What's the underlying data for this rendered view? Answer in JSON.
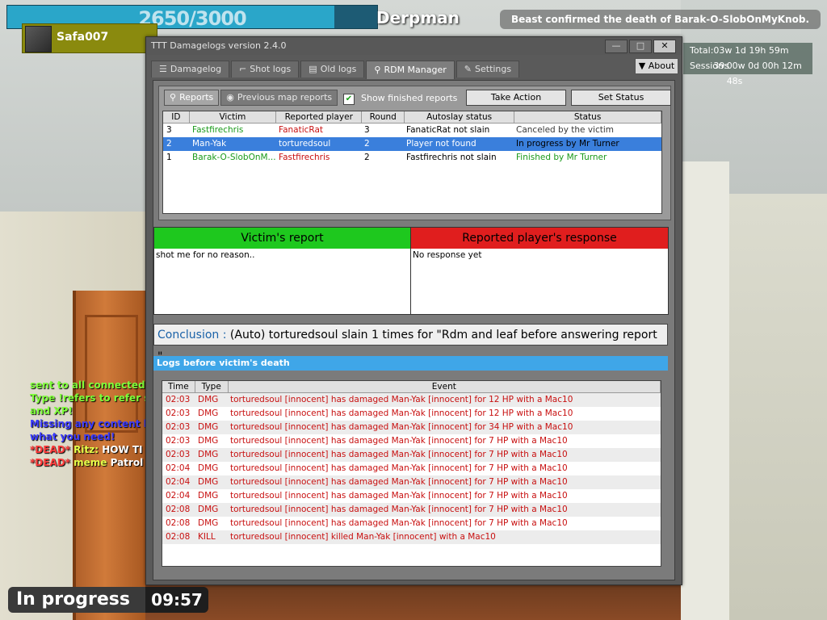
{
  "hud": {
    "health": "2650/3000",
    "health_fraction": 0.8833,
    "target_name": "Derpman",
    "player_name": "Safa007",
    "killfeed": "Beast confirmed the death of Barak-O-SlobOnMyKnob.",
    "time_total_label": "Total:",
    "time_total_value": "03w 1d 19h 59m 39s",
    "time_session_label": "Session:",
    "time_session_value": "00w 0d 00h 12m 48s",
    "round_state": "In progress",
    "round_timer": "09:57",
    "chat": [
      {
        "text": "sent to all connected s",
        "color": "#7fff3a"
      },
      {
        "text": "Type !refers to refer s",
        "color": "#7fff3a"
      },
      {
        "text": "and XP!",
        "color": "#7fff3a"
      },
      {
        "text": "Missing any content li",
        "color": "#3c3cff"
      },
      {
        "text": "what you need!",
        "color": "#3c3cff"
      },
      {
        "prefix": "*DEAD*",
        "name": "Ritz:",
        "text": "HOW TI"
      },
      {
        "prefix": "*DEAD*",
        "name": "meme",
        "text": "Patrol"
      }
    ]
  },
  "window": {
    "title": "TTT Damagelogs version 2.4.0",
    "minimize_label": "—",
    "maximize_label": "□",
    "close_label": "✕",
    "about_label": "About",
    "tabs": [
      {
        "label": "Damagelog",
        "icon": "list-icon"
      },
      {
        "label": "Shot logs",
        "icon": "gun-icon"
      },
      {
        "label": "Old logs",
        "icon": "archive-icon"
      },
      {
        "label": "RDM Manager",
        "icon": "magnifier-icon"
      },
      {
        "label": "Settings",
        "icon": "wrench-icon"
      }
    ],
    "active_tab": "RDM Manager"
  },
  "rdm": {
    "sub_tabs": [
      {
        "label": "Reports",
        "icon": "magnifier-icon"
      },
      {
        "label": "Previous map reports",
        "icon": "globe-icon"
      }
    ],
    "show_finished_label": "Show finished reports",
    "show_finished_checked": true,
    "take_action_label": "Take Action",
    "set_status_label": "Set Status",
    "columns": [
      "ID",
      "Victim",
      "Reported player",
      "Round",
      "Autoslay status",
      "Status"
    ],
    "rows": [
      {
        "id": "3",
        "victim": "Fastfirechris",
        "reported": "FanaticRat",
        "round": "3",
        "autoslay": "FanaticRat not slain",
        "status": "Canceled by the victim",
        "status_color": "#3a3a3a",
        "selected": false
      },
      {
        "id": "2",
        "victim": "Man-Yak",
        "reported": "torturedsoul",
        "round": "2",
        "autoslay": "Player not found",
        "status": "In progress by Mr Turner",
        "status_color": "#000000",
        "selected": true
      },
      {
        "id": "1",
        "victim": "Barak-O-SlobOnM...",
        "reported": "Fastfirechris",
        "round": "2",
        "autoslay": "Fastfirechris not slain",
        "status": "Finished by Mr Turner",
        "status_color": "#1a9a1a",
        "selected": false
      }
    ],
    "victim_report_title": "Victim's report",
    "victim_report_text": "shot me for no reason..",
    "response_title": "Reported player's response",
    "response_text": "No response yet",
    "conclusion_label": "Conclusion :",
    "conclusion_text": "(Auto) torturedsoul slain 1 times for \"Rdm and leaf before answering report \".",
    "logs_header": "Logs before victim's death",
    "log_columns": [
      "Time",
      "Type",
      "Event"
    ],
    "logs": [
      {
        "time": "02:03",
        "type": "DMG",
        "event": "torturedsoul [innocent] has damaged Man-Yak [innocent] for 12 HP with a Mac10"
      },
      {
        "time": "02:03",
        "type": "DMG",
        "event": "torturedsoul [innocent] has damaged Man-Yak [innocent] for 12 HP with a Mac10"
      },
      {
        "time": "02:03",
        "type": "DMG",
        "event": "torturedsoul [innocent] has damaged Man-Yak [innocent] for 34 HP with a Mac10"
      },
      {
        "time": "02:03",
        "type": "DMG",
        "event": "torturedsoul [innocent] has damaged Man-Yak [innocent] for 7 HP with a Mac10"
      },
      {
        "time": "02:03",
        "type": "DMG",
        "event": "torturedsoul [innocent] has damaged Man-Yak [innocent] for 7 HP with a Mac10"
      },
      {
        "time": "02:04",
        "type": "DMG",
        "event": "torturedsoul [innocent] has damaged Man-Yak [innocent] for 7 HP with a Mac10"
      },
      {
        "time": "02:04",
        "type": "DMG",
        "event": "torturedsoul [innocent] has damaged Man-Yak [innocent] for 7 HP with a Mac10"
      },
      {
        "time": "02:04",
        "type": "DMG",
        "event": "torturedsoul [innocent] has damaged Man-Yak [innocent] for 7 HP with a Mac10"
      },
      {
        "time": "02:08",
        "type": "DMG",
        "event": "torturedsoul [innocent] has damaged Man-Yak [innocent] for 7 HP with a Mac10"
      },
      {
        "time": "02:08",
        "type": "DMG",
        "event": "torturedsoul [innocent] has damaged Man-Yak [innocent] for 7 HP with a Mac10"
      },
      {
        "time": "02:08",
        "type": "KILL",
        "event": "torturedsoul [innocent] killed Man-Yak [innocent] with a Mac10"
      }
    ]
  },
  "colors": {
    "victim_header": "#1ec81e",
    "response_header": "#e01e1e",
    "logs_header": "#3fa6e8",
    "selected_row": "#3a7fdc",
    "log_text": "#c81010"
  }
}
